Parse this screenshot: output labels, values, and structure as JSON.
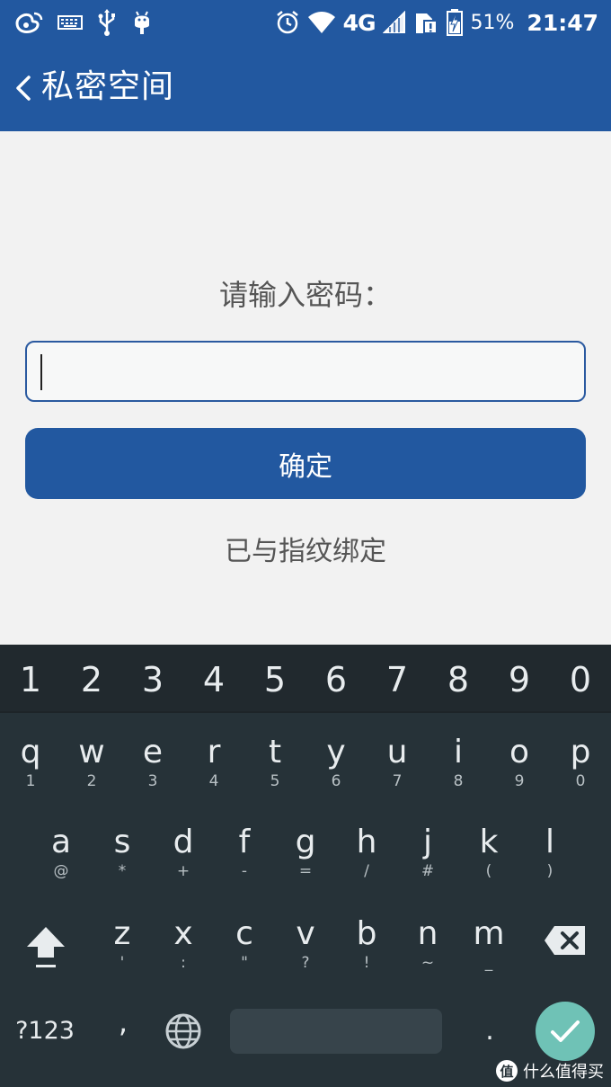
{
  "status_bar": {
    "icons_left": [
      "weibo-icon",
      "keyboard-icon",
      "usb-icon",
      "android-icon"
    ],
    "icons_right": [
      "alarm-icon",
      "wifi-icon",
      "signal-icon",
      "sim-alert-icon",
      "battery-icon"
    ],
    "network": "4G",
    "battery": "51%",
    "time": "21:47"
  },
  "app_bar": {
    "title": "私密空间",
    "back_icon": "chevron-left-icon"
  },
  "form": {
    "prompt": "请输入密码：",
    "password_value": "",
    "confirm_label": "确定",
    "fingerprint_text": "已与指纹绑定"
  },
  "keyboard": {
    "numbers": [
      "1",
      "2",
      "3",
      "4",
      "5",
      "6",
      "7",
      "8",
      "9",
      "0"
    ],
    "row1": [
      {
        "main": "q",
        "sub": "1"
      },
      {
        "main": "w",
        "sub": "2"
      },
      {
        "main": "e",
        "sub": "3"
      },
      {
        "main": "r",
        "sub": "4"
      },
      {
        "main": "t",
        "sub": "5"
      },
      {
        "main": "y",
        "sub": "6"
      },
      {
        "main": "u",
        "sub": "7"
      },
      {
        "main": "i",
        "sub": "8"
      },
      {
        "main": "o",
        "sub": "9"
      },
      {
        "main": "p",
        "sub": "0"
      }
    ],
    "row2": [
      {
        "main": "a",
        "sub": "@"
      },
      {
        "main": "s",
        "sub": "*"
      },
      {
        "main": "d",
        "sub": "+"
      },
      {
        "main": "f",
        "sub": "-"
      },
      {
        "main": "g",
        "sub": "="
      },
      {
        "main": "h",
        "sub": "/"
      },
      {
        "main": "j",
        "sub": "#"
      },
      {
        "main": "k",
        "sub": "("
      },
      {
        "main": "l",
        "sub": ")"
      }
    ],
    "row3": [
      {
        "main": "z",
        "sub": "'"
      },
      {
        "main": "x",
        "sub": ":"
      },
      {
        "main": "c",
        "sub": "\""
      },
      {
        "main": "v",
        "sub": "?"
      },
      {
        "main": "b",
        "sub": "!"
      },
      {
        "main": "n",
        "sub": "~"
      },
      {
        "main": "m",
        "sub": "_"
      }
    ],
    "symbols_label": "?123",
    "comma": ",",
    "period": ".",
    "accent_color": "#6fc2b6"
  },
  "watermark": {
    "logo": "值",
    "text": "什么值得买"
  }
}
